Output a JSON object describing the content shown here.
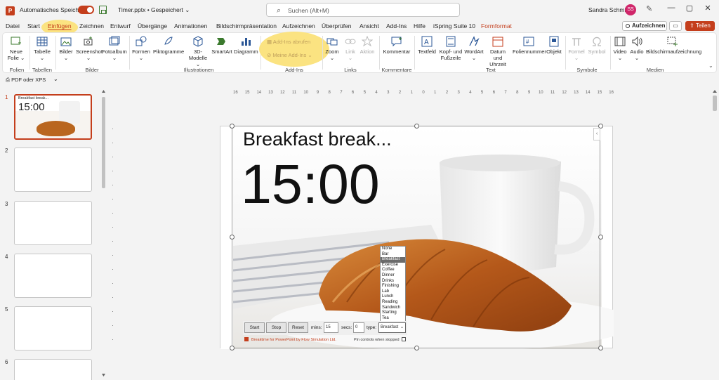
{
  "titlebar": {
    "app_icon": "P",
    "autosave_label": "Automatisches Speichern",
    "doc_title": "Timer.pptx • Gespeichert ⌄",
    "search_placeholder": "Suchen (Alt+M)",
    "user_name": "Sandra Schmid",
    "user_initials": "SS",
    "window_controls": [
      "—",
      "▢",
      "✕"
    ]
  },
  "tabs": [
    "Datei",
    "Start",
    "Einfügen",
    "Zeichnen",
    "Entwurf",
    "Übergänge",
    "Animationen",
    "Bildschirmpräsentation",
    "Aufzeichnen",
    "Überprüfen",
    "Ansicht",
    "Add-Ins",
    "Hilfe",
    "iSpring Suite 10",
    "Formformat"
  ],
  "active_tab": "Einfügen",
  "actions": {
    "record": "Aufzeichnen",
    "share": "Teilen"
  },
  "ribbon": {
    "new_slide": "Neue Folie ⌄",
    "table": "Tabelle ⌄",
    "pictures": "Bilder ⌄",
    "screenshot": "Screenshot ⌄",
    "photo_album": "Fotoalbum ⌄",
    "shapes": "Formen ⌄",
    "icons": "Piktogramme",
    "models3d": "3D-Modelle ⌄",
    "smartart": "SmartArt",
    "chart": "Diagramm",
    "get_addins": "Add-Ins abrufen",
    "my_addins": "Meine Add-Ins ⌄",
    "zoom": "Zoom ⌄",
    "link": "Link ⌄",
    "action": "Aktion",
    "comment": "Kommentar",
    "textbox": "Textfeld",
    "header_footer": "Kopf- und Fußzeile",
    "wordart": "WordArt ⌄",
    "date_time": "Datum und Uhrzeit",
    "slide_number": "Foliennummer",
    "object": "Objekt",
    "equation": "Formel ⌄",
    "symbol": "Symbol",
    "video": "Video ⌄",
    "audio": "Audio ⌄",
    "screen_recording": "Bildschirmaufzeichnung",
    "groups": {
      "folien": "Folien",
      "tabellen": "Tabellen",
      "bilder": "Bilder",
      "illustrationen": "Illustrationen",
      "addins": "Add-Ins",
      "links": "Links",
      "kommentare": "Kommentare",
      "text": "Text",
      "symbole": "Symbole",
      "medien": "Medien"
    }
  },
  "quick_access": {
    "pdf_xps": "PDF oder XPS",
    "more": "⌄"
  },
  "slides_panel": {
    "numbers": [
      "1",
      "2",
      "3",
      "4",
      "5",
      "6"
    ],
    "thumb1_title": "Breakfast break...",
    "thumb1_timer": "15:00"
  },
  "ruler": {
    "h_labels": [
      "16",
      "15",
      "14",
      "13",
      "12",
      "11",
      "10",
      "9",
      "8",
      "7",
      "6",
      "5",
      "4",
      "3",
      "2",
      "1",
      "0",
      "1",
      "2",
      "3",
      "4",
      "5",
      "6",
      "7",
      "8",
      "9",
      "10",
      "11",
      "12",
      "13",
      "14",
      "15",
      "16"
    ]
  },
  "slide": {
    "title": "Breakfast break...",
    "timer": "15:00",
    "scroll_button": "‹"
  },
  "timer_addin": {
    "type_options": [
      "None",
      "Bar",
      "Breakfast",
      "Exercise",
      "Coffee",
      "Dinner",
      "Drinks",
      "Finishing",
      "Lab",
      "Lunch",
      "Reading",
      "Sandwich",
      "Starting",
      "Tea"
    ],
    "selected_type": "Breakfast",
    "start": "Start",
    "stop": "Stop",
    "reset": "Reset",
    "mins_label": "mins:",
    "mins_value": "15",
    "secs_label": "secs:",
    "secs_value": "0",
    "type_label": "type:",
    "credit": "Breaktime for PowerPoint by Flow Simulation Ltd.",
    "pin_label": "Pin controls when stopped"
  },
  "colors": {
    "accent": "#c43e1c",
    "highlight": "#fbe27a"
  }
}
